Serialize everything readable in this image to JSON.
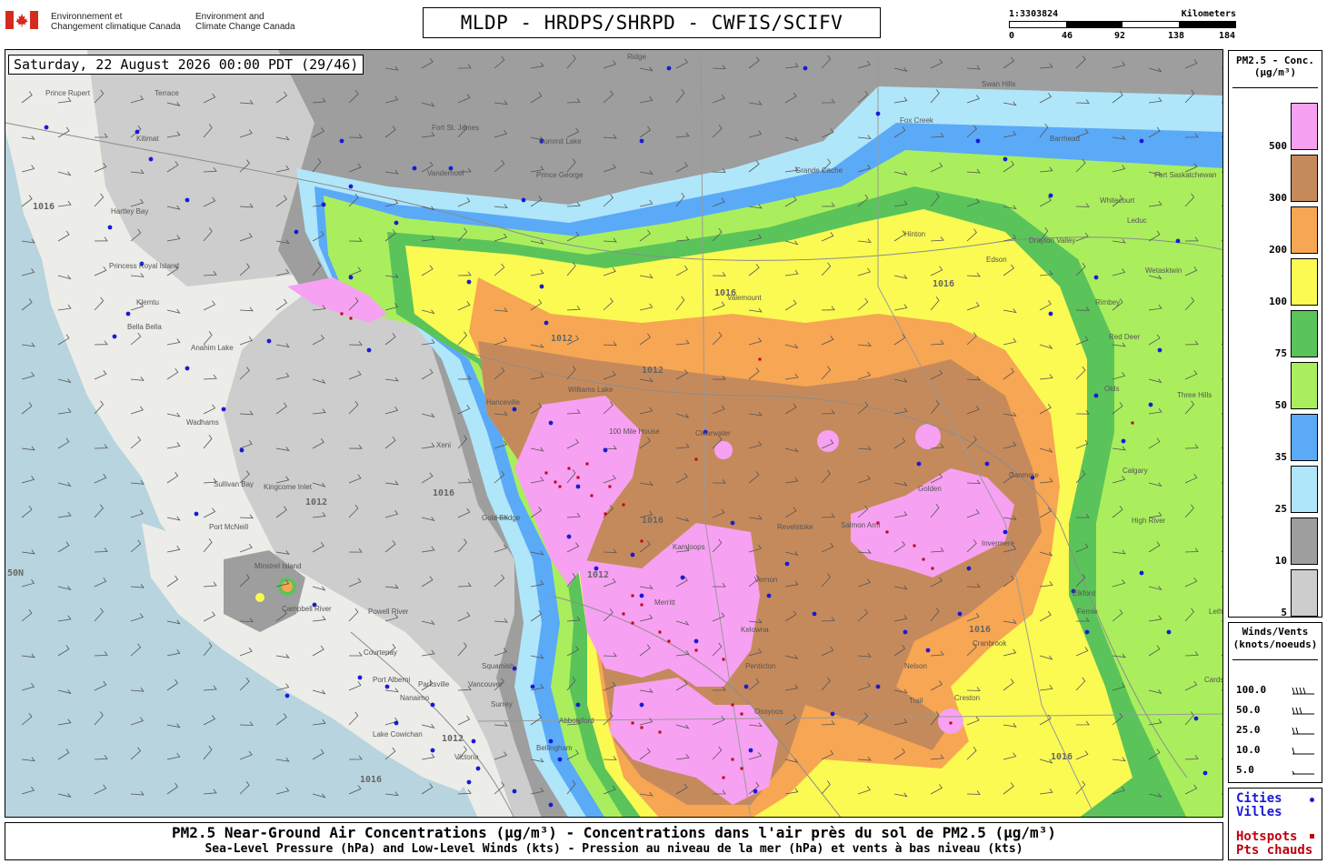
{
  "header": {
    "dept_fr_line1": "Environnement et",
    "dept_fr_line2": "Changement climatique Canada",
    "dept_en_line1": "Environment and",
    "dept_en_line2": "Climate Change Canada",
    "title": "MLDP - HRDPS/SHRPD - CWFIS/SCIFV"
  },
  "scale_bar": {
    "ratio": "1:3303824",
    "unit": "Kilometers",
    "ticks": [
      "0",
      "46",
      "92",
      "138",
      "184"
    ]
  },
  "map": {
    "timestamp": "Saturday, 22 August 2026 00:00 PDT (29/46)",
    "latitude_label": "50N",
    "isobar_labels": [
      "1016",
      "1012",
      "1016",
      "1012",
      "1016",
      "1012",
      "1016",
      "1016",
      "1012",
      "1016",
      "1016",
      "1012",
      "1016"
    ],
    "places": [
      "Prince Rupert",
      "Terrace",
      "Kitimat",
      "Hartley Bay",
      "Princess Royal Island",
      "Klemtu",
      "Bella Bella",
      "Anahim Lake",
      "Wadhams",
      "Port McNeill",
      "Minstrel Island",
      "Sullivan Bay",
      "Kingcome Inlet",
      "Campbell River",
      "Powell River",
      "Courtenay",
      "Port Alberni",
      "Parksville",
      "Nanaimo",
      "Lake Cowichan",
      "Victoria",
      "Squamish",
      "Vancouver",
      "Surrey",
      "Abbotsford",
      "Bellingham",
      "Gold Bridge",
      "Xeni",
      "Hanceville",
      "Williams Lake",
      "100 Mile House",
      "Clearwater",
      "Kamloops",
      "Merritt",
      "Kelowna",
      "Penticton",
      "Osoyoos",
      "Vernon",
      "Salmon Arm",
      "Revelstoke",
      "Golden",
      "Invermere",
      "Nelson",
      "Cranbrook",
      "Fernie",
      "Creston",
      "Trail",
      "Valemount",
      "Prince George",
      "Vanderhoof",
      "Fort St. James",
      "Summit Lake",
      "Grande Cache",
      "Hinton",
      "Edson",
      "Drayton Valley",
      "Whitecourt",
      "Barrhead",
      "Swan Hills",
      "Fort Saskatchewan",
      "Leduc",
      "Wetaskiwin",
      "Rimbey",
      "Red Deer",
      "Olds",
      "Three Hills",
      "Calgary",
      "High River",
      "Canmore",
      "Lethbridge",
      "Cardston",
      "Elkford",
      "Ridge",
      "Fox Creek"
    ]
  },
  "legend": {
    "title_line1": "PM2.5 - Conc.",
    "title_line2": "(µg/m³)",
    "levels": [
      {
        "label": "500",
        "color": "#f7a1f2"
      },
      {
        "label": "300",
        "color": "#c58a5c"
      },
      {
        "label": "200",
        "color": "#f7a653"
      },
      {
        "label": "100",
        "color": "#fafa53"
      },
      {
        "label": "75",
        "color": "#5ac45a"
      },
      {
        "label": "50",
        "color": "#aaee5e"
      },
      {
        "label": "35",
        "color": "#5aaaf7"
      },
      {
        "label": "25",
        "color": "#b0e6fa"
      },
      {
        "label": "10",
        "color": "#9e9e9e"
      },
      {
        "label": "5",
        "color": "#cdcdcd"
      }
    ]
  },
  "winds_legend": {
    "title_line1": "Winds/Vents",
    "title_line2": "(knots/noeuds)",
    "rows": [
      "100.0",
      "50.0",
      "25.0",
      "10.0",
      "5.0"
    ]
  },
  "markers_legend": {
    "cities_line1": "Cities",
    "cities_line2": "Villes",
    "hotspots_line1": "Hotspots",
    "hotspots_line2": "Pts chauds",
    "city_color": "#1a1ad6",
    "hotspot_color": "#c00010"
  },
  "footer": {
    "line1": "PM2.5 Near-Ground Air Concentrations (µg/m³) - Concentrations dans l'air près du sol de PM2.5 (µg/m³)",
    "line2": "Sea-Level Pressure (hPa) and Low-Level Winds (kts) - Pression au niveau de la mer (hPa) et vents à bas niveau (kts)"
  }
}
